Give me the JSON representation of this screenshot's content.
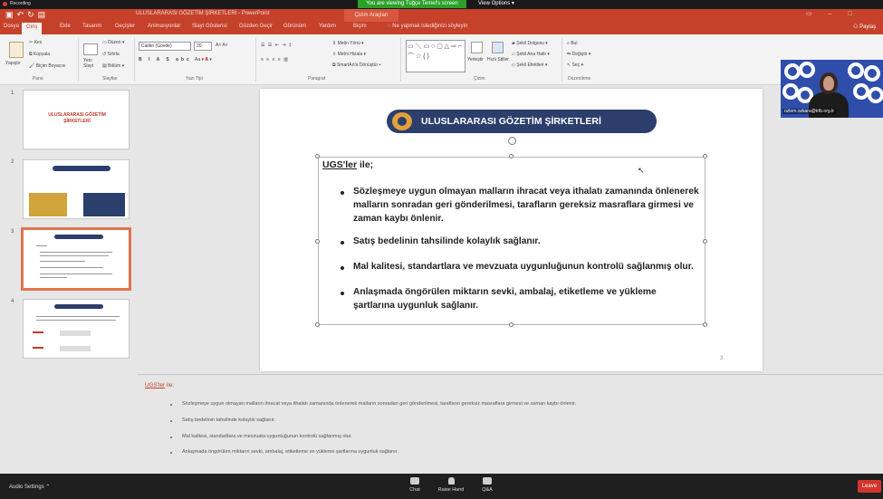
{
  "zoom": {
    "recording_label": "Recording",
    "viewing_banner": "You are viewing Tuğçe Temel's screen",
    "view_options": "View Options",
    "audio_settings": "Audio Settings",
    "chat": "Chat",
    "raise_hand": "Raise Hand",
    "qa": "Q&A",
    "leave": "Leave",
    "webcam_name": "ozlem.ozkara@trtb.org.tr"
  },
  "ppt": {
    "window_title": "ULUSLARARASI GÖZETİM ŞİRKETLERİ - PowerPoint",
    "context_tools": "Çizim Araçları",
    "tabs": [
      "Dosya",
      "Giriş",
      "Ekle",
      "Tasarım",
      "Geçişler",
      "Animasyonlar",
      "Slayt Gösterisi",
      "Gözden Geçir",
      "Görünüm",
      "Yardım",
      "Biçim"
    ],
    "active_tab": "Giriş",
    "tell_me": "Ne yapmak istediğinizi söyleyin",
    "share": "Paylaş",
    "ribbon": {
      "pano": {
        "label": "Pano",
        "paste": "Yapıştır",
        "cut": "Kes",
        "copy": "Kopyala",
        "format_painter": "Biçim Boyacısı"
      },
      "slaytlar": {
        "label": "Slaytlar",
        "new_slide": "Yeni Slayt",
        "layout": "Düzen",
        "reset": "Sıfırla",
        "section": "Bölüm"
      },
      "yazi_tipi": {
        "label": "Yazı Tipi",
        "font": "Calibri (Gövde)",
        "size": "20"
      },
      "paragraf": {
        "label": "Paragraf",
        "text_direction": "Metin Yönü",
        "align_text": "Metni Hizala",
        "smartart": "SmartArt'a Dönüştür"
      },
      "cizim": {
        "label": "Çizim",
        "arrange": "Yerleştir",
        "quick_styles": "Hızlı Stiller",
        "shape_fill": "Şekil Dolgusu",
        "shape_outline": "Şekil Ana Hattı",
        "shape_effects": "Şekil Efektleri"
      },
      "duzenleme": {
        "label": "Düzenleme",
        "find": "Bul",
        "replace": "Değiştir",
        "select": "Seç"
      }
    }
  },
  "thumbnails": [
    {
      "num": "1",
      "title": "ULUSLARARASI GÖZETİM ŞİRKETLERİ"
    },
    {
      "num": "2"
    },
    {
      "num": "3"
    },
    {
      "num": "4"
    }
  ],
  "slide": {
    "title": "ULUSLARARASI GÖZETİM ŞİRKETLERİ",
    "intro_abbr": "UGS'ler",
    "intro_rest": " ile;",
    "bullets": [
      "Sözleşmeye uygun olmayan malların ihracat veya ithalatı zamanında önlenerek malların sonradan geri gönderilmesi, tarafların gereksiz masraflara girmesi ve zaman kaybı önlenir.",
      "Satış bedelinin tahsilinde kolaylık sağlanır.",
      "Mal kalitesi, standartlara ve mevzuata uygunluğunun kontrolü sağlanmış olur.",
      "Anlaşmada öngörülen miktarın sevki, ambalaj, etiketleme ve yükleme şartlarına uygunluk sağlanır."
    ],
    "page_number": "3"
  },
  "notes": {
    "intro_abbr": "UGS'ler",
    "intro_rest": " ile:",
    "lines": [
      "Sözleşmeye uygun olmayan malların ihracat veya ithalatı zamanında önlenerek malların sonradan geri gönderilmesi, tarafların gereksiz masraflara girmesi ve zaman kaybı önlenir.",
      "Satış bedelinin tahsilinde kolaylık sağlanır.",
      "Mal kalitesi, standartlara ve mevzuata uygunluğunun kontrolü sağlanmış olur.",
      "Anlaşmada öngörülen miktarın sevki, ambalaj, etiketleme ve yükleme şartlarına uygunluk sağlanır."
    ]
  },
  "colors": {
    "ppt_accent": "#c6412a",
    "title_pill": "#2c3e6c",
    "title_circle": "#e2a039",
    "zoom_green": "#2aa12a",
    "leave_red": "#d3352c"
  }
}
